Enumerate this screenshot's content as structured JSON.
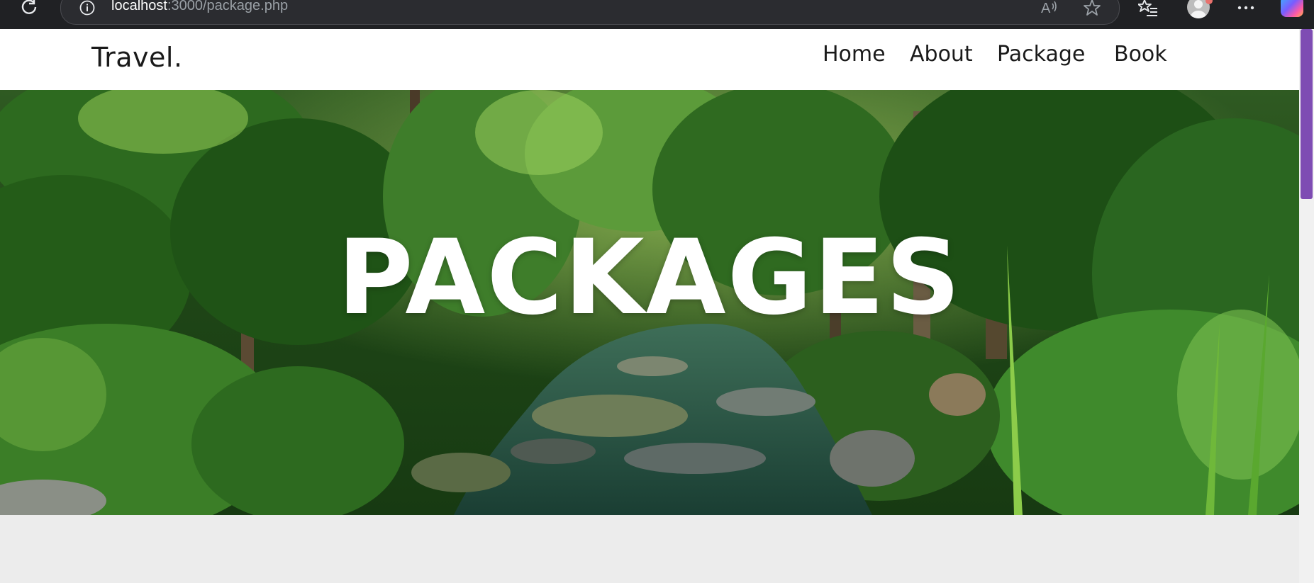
{
  "browser": {
    "url_host": "localhost",
    "url_path": ":3000/package.php",
    "icons": [
      "reload-icon",
      "info-icon",
      "read-aloud-icon",
      "favorite-star-icon",
      "favorites-list-icon",
      "profile-avatar",
      "more-icon",
      "copilot-icon"
    ]
  },
  "site": {
    "logo": "Travel.",
    "nav": {
      "home": "Home",
      "about": "About",
      "package": "Package",
      "book": "Book"
    },
    "hero": {
      "title": "PACKAGES"
    }
  },
  "colors": {
    "browser_bg": "#202124",
    "scroll_thumb": "#7e4cb3",
    "page_bg": "#ececec",
    "navbar_bg": "#ffffff"
  }
}
